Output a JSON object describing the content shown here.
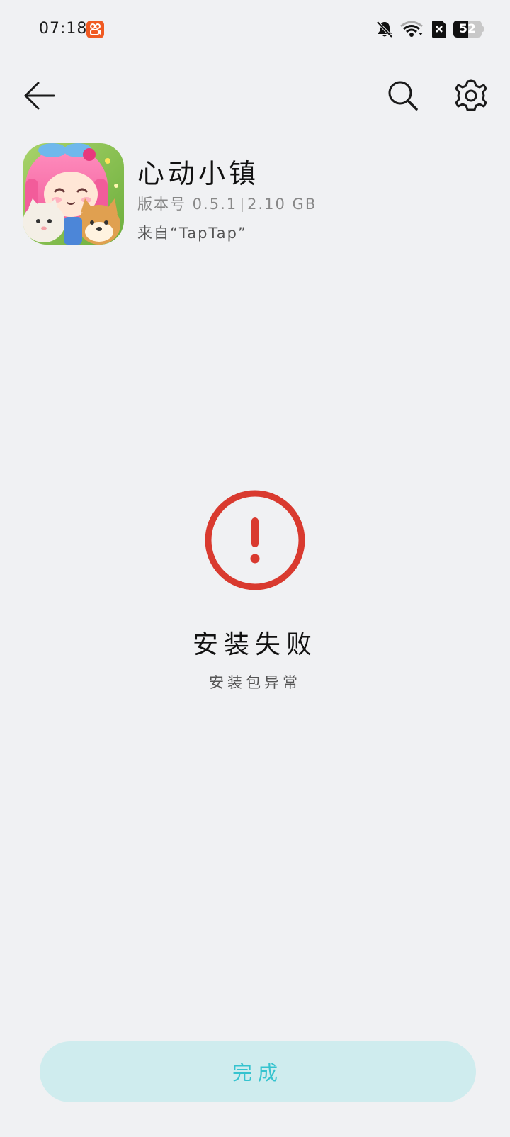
{
  "status_bar": {
    "time": "07:18",
    "battery_level": "52",
    "notif_app_icon": "kuaishou-icon",
    "icons": [
      "bell-muted-icon",
      "wifi-icon",
      "sim-blocked-icon",
      "battery-icon"
    ]
  },
  "top_bar": {
    "back_icon": "back-arrow-icon",
    "search_icon": "search-icon",
    "settings_icon": "gear-icon"
  },
  "app": {
    "name": "心动小镇",
    "version_label": "版本号 0.5.1",
    "size": "2.10 GB",
    "source": "来自“TapTap”",
    "icon": "app-icon-heartbeat-town"
  },
  "result": {
    "icon": "error-exclamation-icon",
    "title": "安装失败",
    "subtitle": "安装包异常"
  },
  "actions": {
    "done_label": "完成"
  },
  "colors": {
    "background": "#f0f1f3",
    "error_red": "#d93a2f",
    "button_bg": "#cfecee",
    "button_text": "#35c3cf",
    "notif_orange": "#f05a22"
  }
}
